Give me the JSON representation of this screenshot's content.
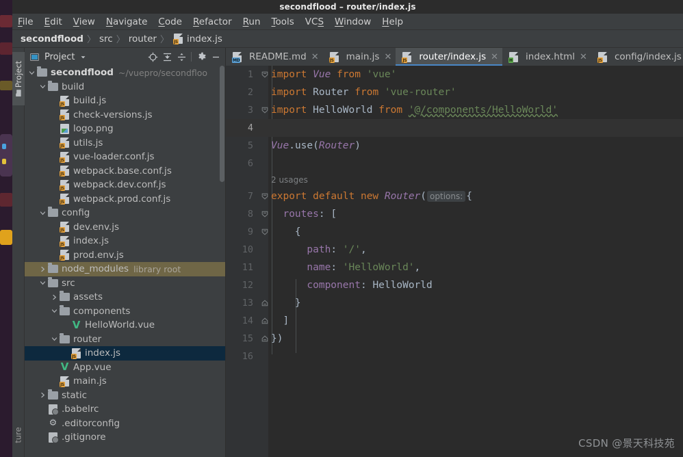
{
  "window": {
    "title": "secondflood – router/index.js"
  },
  "menubar": {
    "items": [
      {
        "label": "File",
        "mnemonic": "F"
      },
      {
        "label": "Edit",
        "mnemonic": "E"
      },
      {
        "label": "View",
        "mnemonic": "V"
      },
      {
        "label": "Navigate",
        "mnemonic": "N"
      },
      {
        "label": "Code",
        "mnemonic": "C"
      },
      {
        "label": "Refactor",
        "mnemonic": "R"
      },
      {
        "label": "Run",
        "mnemonic": "R"
      },
      {
        "label": "Tools",
        "mnemonic": "T"
      },
      {
        "label": "VCS",
        "mnemonic": "S"
      },
      {
        "label": "Window",
        "mnemonic": "W"
      },
      {
        "label": "Help",
        "mnemonic": "H"
      }
    ]
  },
  "breadcrumb": {
    "items": [
      "secondflood",
      "src",
      "router",
      "index.js"
    ],
    "separator": "〉",
    "file_icon": "js-file-icon"
  },
  "tool_window_tabs": {
    "left_top": "Project",
    "left_bottom": "ture"
  },
  "project_panel": {
    "title": "Project",
    "toolbar": [
      {
        "name": "dropdown-arrow-icon",
        "glyph": "▾"
      },
      {
        "name": "locate-file-icon",
        "glyph": "⊕"
      },
      {
        "name": "expand-all-icon",
        "glyph": "⤓"
      },
      {
        "name": "collapse-all-icon",
        "glyph": "⤒"
      },
      {
        "name": "settings-gear-icon",
        "glyph": "⚙"
      },
      {
        "name": "hide-panel-icon",
        "glyph": "—"
      }
    ],
    "tree": [
      {
        "label": "secondflood",
        "sub": "~/vuepro/secondfloo",
        "indent": 0,
        "icon": "folder",
        "arrow": "open",
        "bold": true
      },
      {
        "label": "build",
        "sub": "",
        "indent": 1,
        "icon": "folder",
        "arrow": "open",
        "bold": false
      },
      {
        "label": "build.js",
        "sub": "",
        "indent": 2,
        "icon": "js",
        "arrow": "none",
        "bold": false
      },
      {
        "label": "check-versions.js",
        "sub": "",
        "indent": 2,
        "icon": "js",
        "arrow": "none",
        "bold": false
      },
      {
        "label": "logo.png",
        "sub": "",
        "indent": 2,
        "icon": "img",
        "arrow": "none",
        "bold": false
      },
      {
        "label": "utils.js",
        "sub": "",
        "indent": 2,
        "icon": "js",
        "arrow": "none",
        "bold": false
      },
      {
        "label": "vue-loader.conf.js",
        "sub": "",
        "indent": 2,
        "icon": "js",
        "arrow": "none",
        "bold": false
      },
      {
        "label": "webpack.base.conf.js",
        "sub": "",
        "indent": 2,
        "icon": "js",
        "arrow": "none",
        "bold": false
      },
      {
        "label": "webpack.dev.conf.js",
        "sub": "",
        "indent": 2,
        "icon": "js",
        "arrow": "none",
        "bold": false
      },
      {
        "label": "webpack.prod.conf.js",
        "sub": "",
        "indent": 2,
        "icon": "js",
        "arrow": "none",
        "bold": false
      },
      {
        "label": "config",
        "sub": "",
        "indent": 1,
        "icon": "folder",
        "arrow": "open",
        "bold": false
      },
      {
        "label": "dev.env.js",
        "sub": "",
        "indent": 2,
        "icon": "js",
        "arrow": "none",
        "bold": false
      },
      {
        "label": "index.js",
        "sub": "",
        "indent": 2,
        "icon": "js",
        "arrow": "none",
        "bold": false
      },
      {
        "label": "prod.env.js",
        "sub": "",
        "indent": 2,
        "icon": "js",
        "arrow": "none",
        "bold": false
      },
      {
        "label": "node_modules",
        "sub": "library root",
        "indent": 1,
        "icon": "folder",
        "arrow": "closed",
        "bold": false,
        "state": "libroot"
      },
      {
        "label": "src",
        "sub": "",
        "indent": 1,
        "icon": "folder",
        "arrow": "open",
        "bold": false
      },
      {
        "label": "assets",
        "sub": "",
        "indent": 2,
        "icon": "folder",
        "arrow": "closed",
        "bold": false
      },
      {
        "label": "components",
        "sub": "",
        "indent": 2,
        "icon": "folder",
        "arrow": "open",
        "bold": false
      },
      {
        "label": "HelloWorld.vue",
        "sub": "",
        "indent": 3,
        "icon": "vue",
        "arrow": "none",
        "bold": false
      },
      {
        "label": "router",
        "sub": "",
        "indent": 2,
        "icon": "folder",
        "arrow": "open",
        "bold": false
      },
      {
        "label": "index.js",
        "sub": "",
        "indent": 3,
        "icon": "js",
        "arrow": "none",
        "bold": false,
        "state": "selected"
      },
      {
        "label": "App.vue",
        "sub": "",
        "indent": 2,
        "icon": "vue",
        "arrow": "none",
        "bold": false
      },
      {
        "label": "main.js",
        "sub": "",
        "indent": 2,
        "icon": "js",
        "arrow": "none",
        "bold": false
      },
      {
        "label": "static",
        "sub": "",
        "indent": 1,
        "icon": "folder",
        "arrow": "closed",
        "bold": false
      },
      {
        "label": ".babelrc",
        "sub": "",
        "indent": 1,
        "icon": "dotfile",
        "arrow": "none",
        "bold": false
      },
      {
        "label": ".editorconfig",
        "sub": "",
        "indent": 1,
        "icon": "gear",
        "arrow": "none",
        "bold": false
      },
      {
        "label": ".gitignore",
        "sub": "",
        "indent": 1,
        "icon": "dotfile",
        "arrow": "none",
        "bold": false
      }
    ]
  },
  "editor_tabs": [
    {
      "label": "README.md",
      "type": "md",
      "active": false,
      "closable": true
    },
    {
      "label": "main.js",
      "type": "js",
      "active": false,
      "closable": true
    },
    {
      "label": "router/index.js",
      "type": "js",
      "active": true,
      "closable": true
    },
    {
      "label": "index.html",
      "type": "h",
      "active": false,
      "closable": true
    },
    {
      "label": "config/index.js",
      "type": "js",
      "active": false,
      "closable": true
    }
  ],
  "editor": {
    "caret_line": 4,
    "code_vision": "2 usages",
    "inlay_hint": "options:",
    "lines": [
      {
        "n": 1,
        "fold": "open"
      },
      {
        "n": 2,
        "fold": "none"
      },
      {
        "n": 3,
        "fold": "open"
      },
      {
        "n": 4,
        "fold": "none"
      },
      {
        "n": 5,
        "fold": "none"
      },
      {
        "n": 6,
        "fold": "none"
      },
      {
        "n": 7,
        "fold": "open"
      },
      {
        "n": 8,
        "fold": "open"
      },
      {
        "n": 9,
        "fold": "open"
      },
      {
        "n": 10,
        "fold": "none"
      },
      {
        "n": 11,
        "fold": "none"
      },
      {
        "n": 12,
        "fold": "none"
      },
      {
        "n": 13,
        "fold": "close"
      },
      {
        "n": 14,
        "fold": "close"
      },
      {
        "n": 15,
        "fold": "close"
      },
      {
        "n": 16,
        "fold": "none"
      }
    ],
    "source_text": [
      "import Vue from 'vue'",
      "import Router from 'vue-router'",
      "import HelloWorld from '@/components/HelloWorld'",
      "",
      "Vue.use(Router)",
      "",
      "export default new Router({",
      "  routes: [",
      "    {",
      "      path: '/',",
      "      name: 'HelloWorld',",
      "      component: HelloWorld",
      "    }",
      "  ]",
      "})",
      ""
    ]
  },
  "annotation": {
    "arrow_color": "#e81c1c",
    "direction": "left"
  },
  "watermark": {
    "text": "CSDN @景天科技苑"
  },
  "colors": {
    "accent": "#4a88c7",
    "selection": "#0d293e",
    "library_root": "#6f6646",
    "editor_bg": "#2b2b2b",
    "panel_bg": "#3c3f41",
    "keyword": "#cc7832",
    "string": "#6a8759",
    "property": "#9876aa",
    "plain": "#a9b7c6",
    "vue_green": "#41b883"
  }
}
